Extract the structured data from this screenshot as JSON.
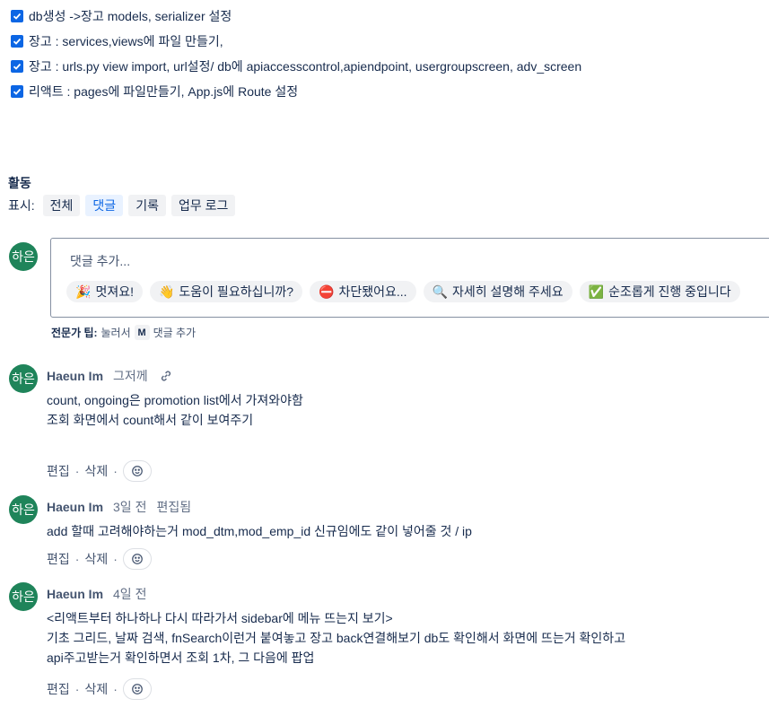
{
  "checklist": [
    {
      "text": "db생성 ->장고 models, serializer 설정",
      "checked": true
    },
    {
      "text": "장고 : services,views에 파일 만들기,",
      "checked": true
    },
    {
      "text": "장고 :  urls.py view import, url설정/ db에 apiaccesscontrol,apiendpoint, usergroupscreen, adv_screen",
      "checked": true
    },
    {
      "text": "리액트 :  pages에 파일만들기, App.js에 Route 설정",
      "checked": true
    }
  ],
  "activity": {
    "title": "활동",
    "filter_label": "표시:",
    "filters": [
      "전체",
      "댓글",
      "기록",
      "업무 로그"
    ],
    "active_filter": "댓글"
  },
  "avatar_initials": "하은",
  "comment_editor": {
    "placeholder": "댓글 추가...",
    "quick_replies": [
      {
        "emoji": "🎉",
        "label": "멋져요!"
      },
      {
        "emoji": "👋",
        "label": "도움이 필요하십니까?"
      },
      {
        "emoji": "⛔",
        "label": "차단됐어요..."
      },
      {
        "emoji": "🔍",
        "label": "자세히 설명해 주세요"
      },
      {
        "emoji": "✅",
        "label": "순조롭게 진행 중입니다"
      }
    ],
    "pro_tip_label": "전문가 팁:",
    "pro_tip_press": "눌러서",
    "pro_tip_key": "M",
    "pro_tip_action": "댓글 추가"
  },
  "comments": [
    {
      "author": "Haeun Im",
      "time": "그저께",
      "edited": "",
      "lines": [
        "count, ongoing은 promotion list에서 가져와야함",
        "조회 화면에서 count해서 같이 보여주기"
      ],
      "actions": [
        "편집",
        "삭제"
      ]
    },
    {
      "author": "Haeun Im",
      "time": "3일 전",
      "edited": "편집됨",
      "lines": [
        "add 할때 고려해야하는거 mod_dtm,mod_emp_id 신규임에도 같이 넣어줄 것 / ip"
      ],
      "actions": [
        "편집",
        "삭제"
      ]
    },
    {
      "author": "Haeun Im",
      "time": "4일 전",
      "edited": "",
      "lines": [
        "<리액트부터 하나하나 다시 따라가서 sidebar에 메뉴 뜨는지 보기>",
        "기초 그리드, 날짜 검색, fnSearch이런거 붙여놓고 장고 back연결해보기 db도 확인해서 화면에 뜨는거 확인하고",
        "api주고받는거 확인하면서 조회 1차, 그 다음에 팝업"
      ],
      "actions": [
        "편집",
        "삭제"
      ]
    }
  ],
  "colors": {
    "accent": "#0c66e4",
    "avatar": "#1f845a"
  }
}
